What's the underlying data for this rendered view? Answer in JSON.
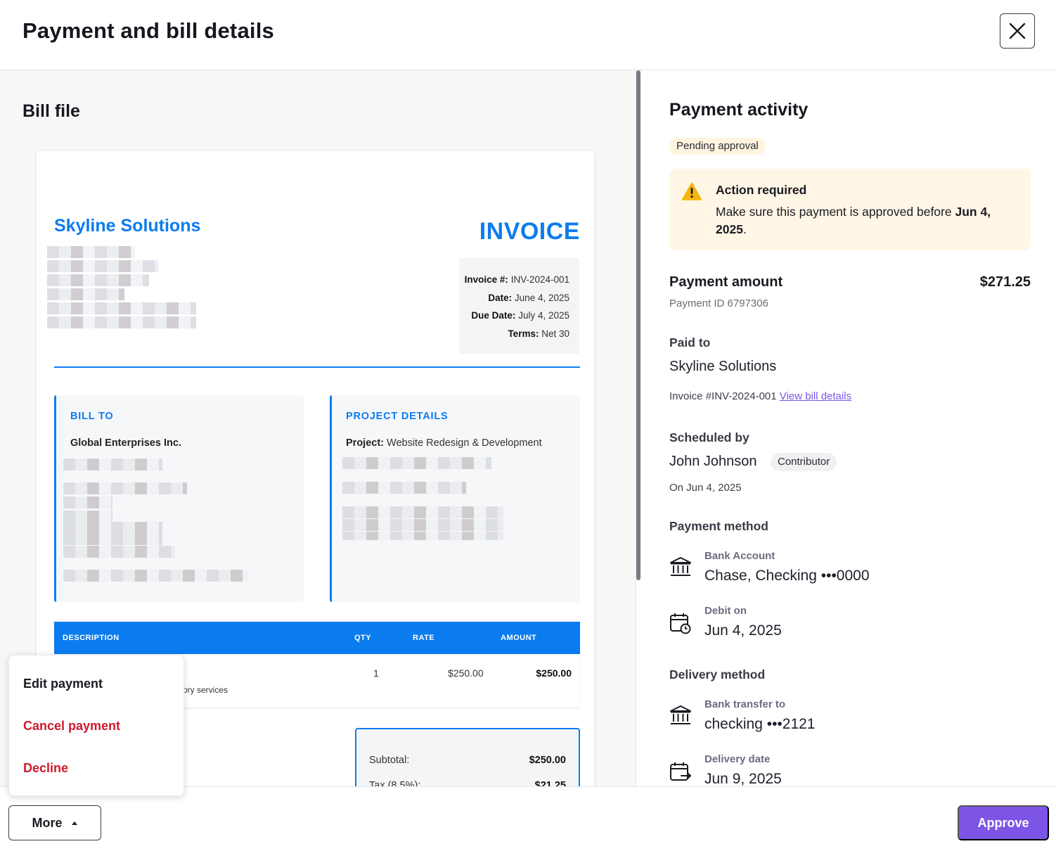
{
  "header": {
    "title": "Payment and bill details"
  },
  "left_pane": {
    "title": "Bill file"
  },
  "invoice": {
    "company": "Skyline Solutions",
    "heading": "INVOICE",
    "meta": [
      {
        "label": "Invoice #:",
        "value": "INV-2024-001"
      },
      {
        "label": "Date:",
        "value": "June 4, 2025"
      },
      {
        "label": "Due Date:",
        "value": "July 4, 2025"
      },
      {
        "label": "Terms:",
        "value": "Net 30"
      }
    ],
    "bill_to": {
      "heading": "BILL TO",
      "name": "Global Enterprises Inc."
    },
    "project": {
      "heading": "PROJECT DETAILS",
      "label": "Project:",
      "value": "Website Redesign & Development"
    },
    "table": {
      "columns": [
        "DESCRIPTION",
        "QTY",
        "RATE",
        "AMOUNT"
      ],
      "row": {
        "description_fragment": "ory services",
        "qty": "1",
        "rate": "$250.00",
        "amount": "$250.00"
      }
    },
    "summary": {
      "subtotal_label": "Subtotal:",
      "subtotal_value": "$250.00",
      "tax_label": "Tax (8.5%):",
      "tax_value": "$21.25"
    }
  },
  "right_pane": {
    "title": "Payment activity",
    "status_badge": "Pending approval",
    "alert": {
      "title": "Action required",
      "message_prefix": "Make sure this payment is approved before ",
      "message_date": "Jun 4, 2025",
      "message_suffix": "."
    },
    "payment_amount_label": "Payment amount",
    "payment_amount_value": "$271.25",
    "payment_id": "Payment ID 6797306",
    "paid_to": {
      "label": "Paid to",
      "name": "Skyline Solutions",
      "invoice_text": "Invoice #INV-2024-001",
      "link_text": "View bill details"
    },
    "scheduled_by": {
      "label": "Scheduled by",
      "name": "John Johnson",
      "role": "Contributor",
      "date": "On Jun 4, 2025"
    },
    "payment_method": {
      "label": "Payment method",
      "account_label": "Bank Account",
      "account_value": "Chase, Checking •••0000",
      "debit_label": "Debit on",
      "debit_value": "Jun 4, 2025"
    },
    "delivery_method": {
      "label": "Delivery method",
      "transfer_label": "Bank transfer to",
      "transfer_value": "checking •••2121",
      "date_label": "Delivery date",
      "date_value": "Jun 9, 2025"
    }
  },
  "menu": {
    "items": [
      {
        "label": "Edit payment",
        "style": "normal"
      },
      {
        "label": "Cancel payment",
        "style": "danger"
      },
      {
        "label": "Decline",
        "style": "danger"
      }
    ]
  },
  "footer": {
    "more_label": "More",
    "approve_label": "Approve"
  },
  "colors": {
    "accent": "#7c55e6",
    "invoice_blue": "#0b7cf0",
    "danger": "#d0192d",
    "alert_bg": "#fff6e6"
  }
}
